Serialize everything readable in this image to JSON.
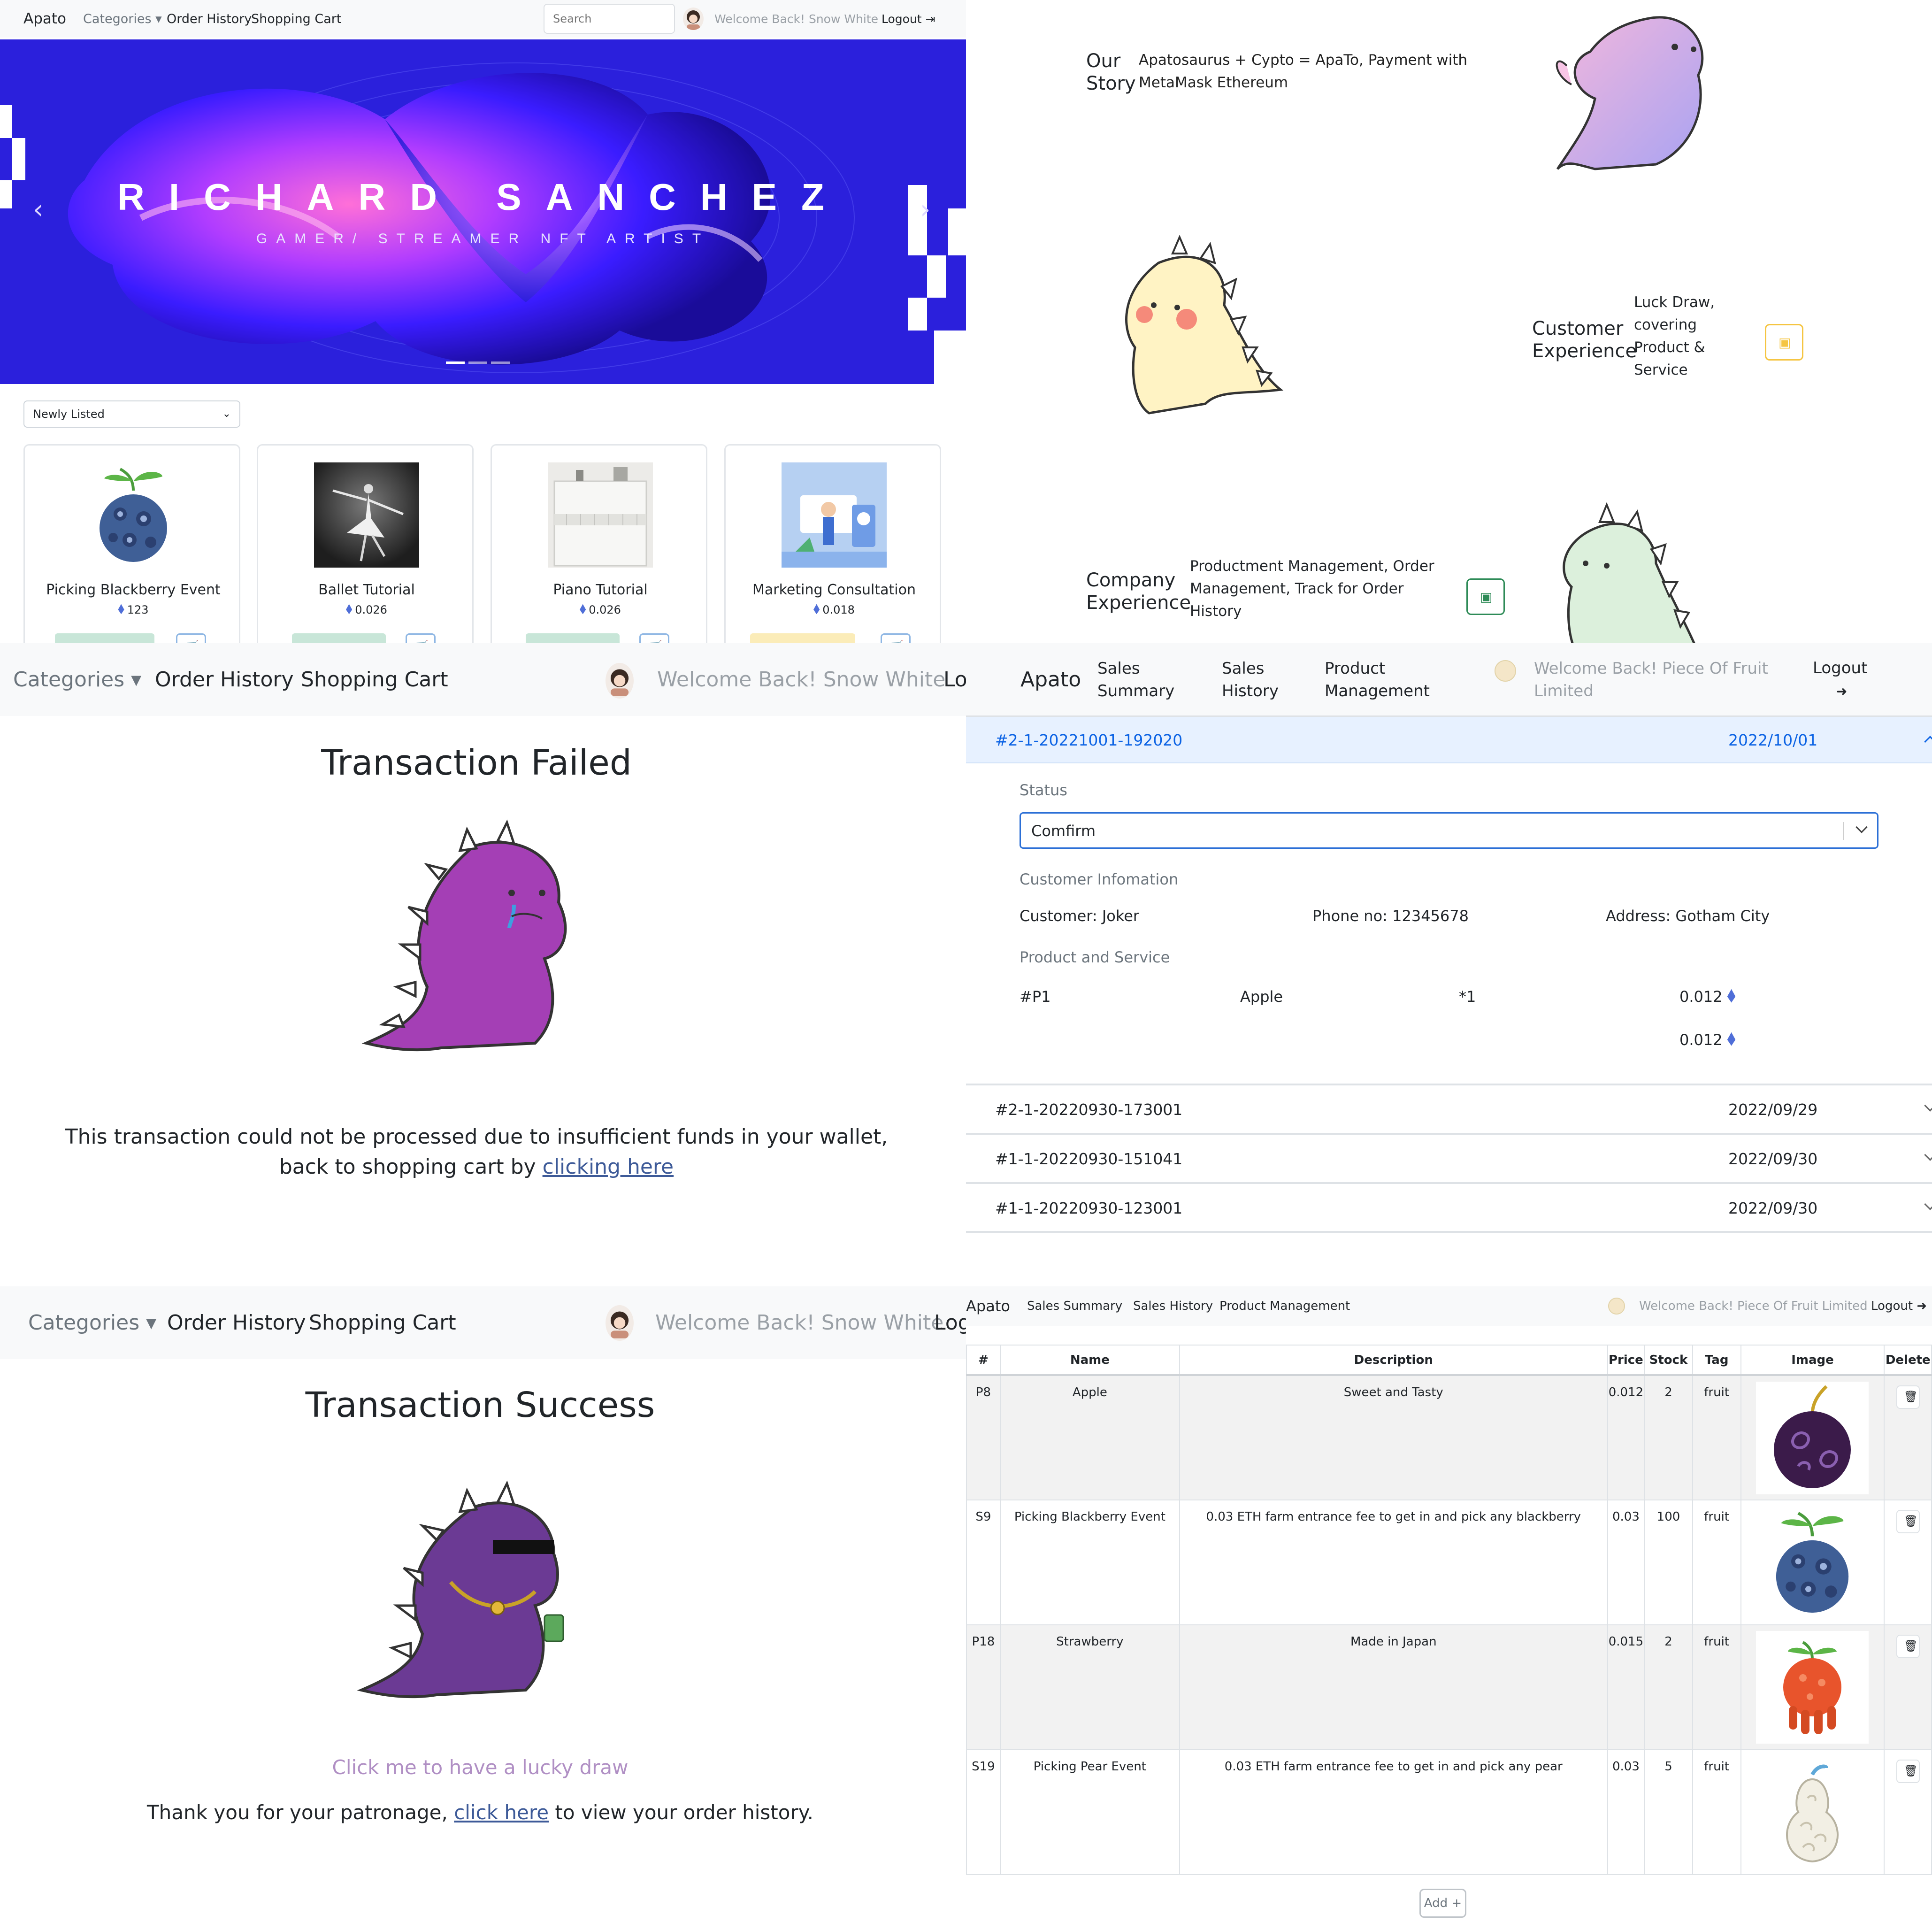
{
  "app": {
    "brand": "Apato"
  },
  "shop_nav": {
    "categories": "Categories",
    "order_history": "Order History",
    "shopping_cart": "Shopping Cart",
    "search_placeholder": "Search",
    "welcome": "Welcome Back! Snow White",
    "logout": "Logout",
    "logout_cut": "Lo",
    "logout_cut2": "Log"
  },
  "hero": {
    "name": "RICHARD SANCHEZ",
    "subtitle": "GAMER/ STREAMER NFT ARTIST",
    "slides": 3,
    "active_slide": 1
  },
  "listing": {
    "sort_selected": "Newly Listed",
    "products": [
      {
        "name": "Picking Blackberry Event",
        "price": "123"
      },
      {
        "name": "Ballet Tutorial",
        "price": "0.026"
      },
      {
        "name": "Piano Tutorial",
        "price": "0.026"
      },
      {
        "name": "Marketing Consultation",
        "price": "0.018"
      }
    ]
  },
  "about": {
    "story_title_1": "Our",
    "story_title_2": "Story",
    "story_text": "Apatosaurus + Cypto = ApaTo, Payment with MetaMask Ethereum",
    "customer_title_1": "Customer",
    "customer_title_2": "Experience",
    "customer_text": "Luck Draw, covering Product & Service",
    "company_title_1": "Company",
    "company_title_2": "Experience",
    "company_text": "Productment Management, Order Management, Track for Order History",
    "colors": {
      "customer_accent": "#f5c542",
      "company_accent": "#2e8b57"
    }
  },
  "failed": {
    "title": "Transaction Failed",
    "message_line1": "This transaction could not be processed due to insufficient funds in your wallet,",
    "message_line2": "back to shopping cart by ",
    "link": "clicking here"
  },
  "success": {
    "title": "Transaction Success",
    "lucky_draw": "Click me to have a lucky draw",
    "thanks": "Thank you for your patronage, ",
    "link": "click here",
    "thanks_end": " to view your order history."
  },
  "seller_nav": {
    "brand": "Apato",
    "sales_summary": "Sales Summary",
    "sales_summary_1": "Sales",
    "sales_summary_2": "Summary",
    "sales_history": "Sales History",
    "sales_history_1": "Sales",
    "sales_history_2": "History",
    "product_management": "Product Management",
    "product_management_1": "Product",
    "product_management_2": "Management",
    "welcome": "Welcome Back! Piece Of Fruit Limited",
    "welcome_1": "Welcome Back! Piece Of Fruit",
    "welcome_2": "Limited",
    "logout": "Logout"
  },
  "orders": {
    "open": {
      "id": "#2-1-20221001-192020",
      "date": "2022/10/01",
      "status_label": "Status",
      "status_value": "Comfirm",
      "customer_label": "Customer Infomation",
      "customer": "Customer: Joker",
      "phone": "Phone no: 12345678",
      "address": "Address: Gotham City",
      "product_label": "Product and Service",
      "item_id": "#P1",
      "item_name": "Apple",
      "item_qty": "*1",
      "item_price": "0.012",
      "total": "0.012"
    },
    "collapsed": [
      {
        "id": "#2-1-20220930-173001",
        "date": "2022/09/29"
      },
      {
        "id": "#1-1-20220930-151041",
        "date": "2022/09/30"
      },
      {
        "id": "#1-1-20220930-123001",
        "date": "2022/09/30"
      }
    ]
  },
  "product_table": {
    "headers": [
      "#",
      "Name",
      "Description",
      "Price",
      "Stock",
      "Tag",
      "Image",
      "Delete"
    ],
    "rows": [
      {
        "id": "P8",
        "name": "Apple",
        "description": "Sweet and Tasty",
        "price": "0.012",
        "stock": "2",
        "tag": "fruit",
        "image": "dark-purple-swirl-fruit"
      },
      {
        "id": "S9",
        "name": "Picking Blackberry Event",
        "description": "0.03 ETH farm entrance fee to get in and pick any blackberry",
        "price": "0.03",
        "stock": "100",
        "tag": "fruit",
        "image": "blue-spiky-swirl-fruit"
      },
      {
        "id": "P18",
        "name": "Strawberry",
        "description": "Made in Japan",
        "price": "0.015",
        "stock": "2",
        "tag": "fruit",
        "image": "orange-tentacle-fruit"
      },
      {
        "id": "S19",
        "name": "Picking Pear Event",
        "description": "0.03 ETH farm entrance fee to get in and pick any pear",
        "price": "0.03",
        "stock": "5",
        "tag": "fruit",
        "image": "white-cloud-pear-fruit"
      }
    ],
    "add_button": "Add +"
  }
}
